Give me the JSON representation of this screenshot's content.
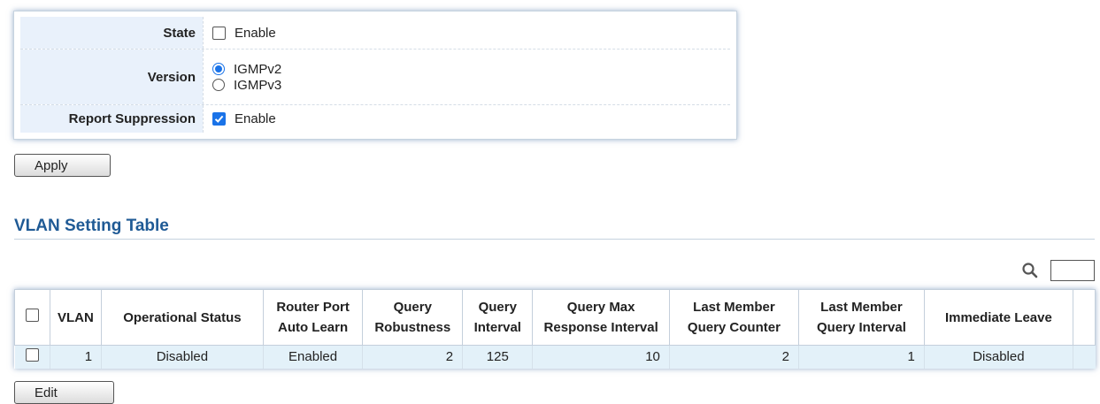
{
  "settings": {
    "state": {
      "label": "State",
      "option": "Enable",
      "checked": false
    },
    "version": {
      "label": "Version",
      "options": [
        {
          "label": "IGMPv2",
          "checked": true
        },
        {
          "label": "IGMPv3",
          "checked": false
        }
      ]
    },
    "report_suppression": {
      "label": "Report Suppression",
      "option": "Enable",
      "checked": true
    },
    "apply_label": "Apply"
  },
  "vlan_table": {
    "title": "VLAN Setting Table",
    "headers": {
      "vlan": "VLAN",
      "operational_status": "Operational Status",
      "router_port_1": "Router Port",
      "router_port_2": "Auto Learn",
      "query_robustness_1": "Query",
      "query_robustness_2": "Robustness",
      "query_interval_1": "Query",
      "query_interval_2": "Interval",
      "query_max_1": "Query Max",
      "query_max_2": "Response Interval",
      "last_member_counter_1": "Last Member",
      "last_member_counter_2": "Query Counter",
      "last_member_interval_1": "Last Member",
      "last_member_interval_2": "Query Interval",
      "immediate_leave": "Immediate Leave"
    },
    "rows": [
      {
        "vlan": "1",
        "operational_status": "Disabled",
        "router_port_auto_learn": "Enabled",
        "query_robustness": "2",
        "query_interval": "125",
        "query_max_response_interval": "10",
        "last_member_query_counter": "2",
        "last_member_query_interval": "1",
        "immediate_leave": "Disabled"
      }
    ],
    "edit_label": "Edit"
  },
  "colors": {
    "accent": "#1a73e8",
    "title": "#1f5a95",
    "label_bg": "#e9f1fb",
    "row_bg": "#e3f1f9"
  },
  "icons": {
    "search": "search-icon"
  }
}
